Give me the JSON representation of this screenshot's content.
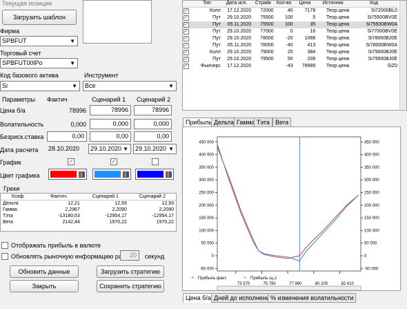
{
  "header": {
    "current_position": "Текущая позиция"
  },
  "left": {
    "load_template": "Загрузить шаблон",
    "firm_label": "Фирма",
    "firm_value": "SPBFUT",
    "account_label": "Торговый счет",
    "account_value": "SPBFUT00lPo",
    "base_code_label": "Код базового актива",
    "base_code_value": "Si",
    "instrument_label": "Инструмент",
    "instrument_value": "Все"
  },
  "params": {
    "h_params": "Параметры",
    "h_fact": "Фактич",
    "h_s1": "Сценарий 1",
    "h_s2": "Сценарий 2",
    "price_label": "Цена б/а",
    "price_fact": "78996",
    "price_s1": "78996",
    "price_s2": "78996",
    "vol_label": "Волатильность",
    "vol_fact": "0,000",
    "vol_s1": "0,000",
    "vol_s2": "0,000",
    "rate_label": "Безриск.ставка",
    "rate_fact": "0,00",
    "rate_s1": "0,00",
    "rate_s2": "0,00",
    "date_label": "Дата расчета",
    "date_fact": "28.10.2020",
    "date_s1": "29.10.2020",
    "date_s2": "29.10.2020",
    "graph_label": "График",
    "color_label": "Цвет графика",
    "colors": {
      "fact": "#ff0000",
      "s1": "#1e90ff",
      "s2": "#0000ff"
    }
  },
  "greeks": {
    "title": "Греки",
    "headers": [
      "Коэф.",
      "Фактич.",
      "Сценарий 1",
      "Сценарий 2"
    ],
    "rows": [
      [
        "Дельта",
        "12,21",
        "12,93",
        "12,93"
      ],
      [
        "Гамма",
        "2,2967",
        "2,2090",
        "2,2090"
      ],
      [
        "Тэта",
        "-13180,63",
        "-12954,17",
        "-12954,17"
      ],
      [
        "Вега",
        "2142,44",
        "1970,22",
        "1970,22"
      ]
    ]
  },
  "options": {
    "show_currency": "Отображать прибыль в валюте",
    "refresh_prefix": "Обновлять рыночную информацию раз в",
    "refresh_value": "20",
    "refresh_suffix": "секунд"
  },
  "buttons": {
    "update": "Обновить данные",
    "load_strategy": "Загрузить стратегию",
    "close": "Закрыть",
    "save_strategy": "Сохранить стратегию"
  },
  "positions": {
    "headers": [
      "Тип",
      "Дата исп.",
      "Страйк",
      "Кол-во",
      "Цена",
      "Источник",
      "Код"
    ],
    "rows": [
      [
        "Колл",
        "17.12.2020",
        "72000",
        "40",
        "7178",
        "Теор.цена",
        "Si72000BL0"
      ],
      [
        "Пут",
        "29.10.2020",
        "75500",
        "100",
        "5",
        "Теор.цена",
        "Si75500BV0E"
      ],
      [
        "Пут",
        "05.11.2020",
        "75500",
        "100",
        "35",
        "Теор.цена",
        "Si75500BW0A"
      ],
      [
        "Пут",
        "29.10.2020",
        "77000",
        "0",
        "16",
        "Теор.цена",
        "Si77000BV0E"
      ],
      [
        "Пут",
        "29.10.2020",
        "78000",
        "-20",
        "1068",
        "Теор.цена",
        "Si78000BJ0E"
      ],
      [
        "Пут",
        "05.11.2020",
        "78000",
        "-40",
        "413",
        "Теор.цена",
        "Si78000BW0A"
      ],
      [
        "Колл",
        "29.10.2020",
        "79000",
        "25",
        "384",
        "Теор.цена",
        "Si79000BJ0E"
      ],
      [
        "Пут",
        "29.10.2020",
        "79500",
        "50",
        "209",
        "Теор.цена",
        "Si79500BJ0E"
      ],
      [
        "Фьючерс",
        "17.12.2020",
        "",
        "-43",
        "78989",
        "Теор.цена",
        "SiZ0"
      ]
    ]
  },
  "chart_tabs": [
    "Прибыль",
    "Дельта",
    "Гамма",
    "Тэта",
    "Вега"
  ],
  "bottom_tabs": [
    "Цена б/а",
    "Дней до исполнения",
    "% изменения волатильности"
  ],
  "chart_data": {
    "type": "line",
    "x": [
      72000,
      73000,
      74000,
      75000,
      75500,
      76000,
      77000,
      78000,
      79000,
      79500,
      80000,
      81000,
      82000,
      83000,
      84000
    ],
    "xticks": [
      "73 570",
      "75 780",
      "77 990",
      "80 200",
      "82 410"
    ],
    "yticks": [
      "450 000",
      "400 000",
      "350 000",
      "300 000",
      "250 000",
      "200 000",
      "150 000",
      "100 000",
      "50 000",
      "0",
      "-50 000"
    ],
    "ylim": [
      -60000,
      470000
    ],
    "xlim": [
      72000,
      84200
    ],
    "series": [
      {
        "name": "Прибыль факт.",
        "values": [
          440000,
          300000,
          170000,
          60000,
          20000,
          5000,
          -5000,
          -10000,
          0,
          30000,
          55000,
          100000,
          150000,
          200000,
          240000
        ]
      },
      {
        "name": "Прибыль сц.1",
        "values": [
          430000,
          310000,
          180000,
          70000,
          20000,
          8000,
          0,
          -5000,
          -20000,
          15000,
          40000,
          90000,
          140000,
          195000,
          240000
        ]
      }
    ],
    "marker_x": 79000,
    "legend": "bottom-left"
  }
}
